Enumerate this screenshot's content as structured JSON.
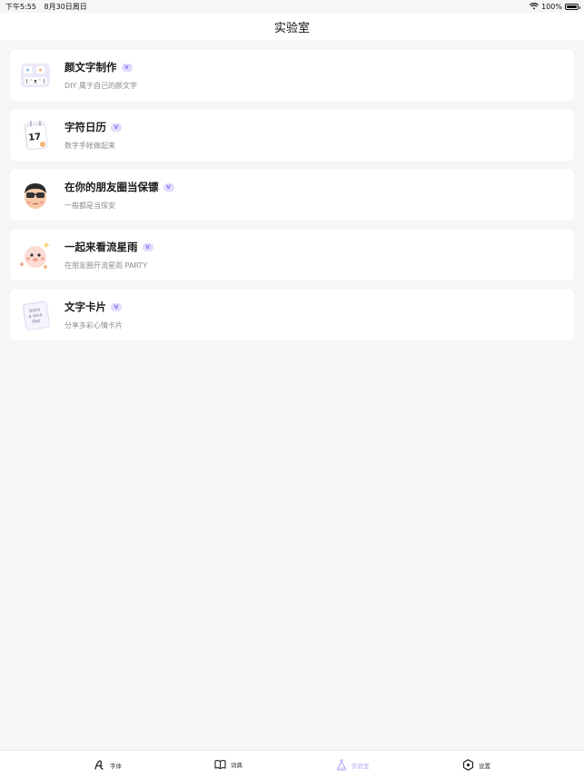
{
  "status_bar": {
    "time": "下午5:55",
    "date": "8月30日周日",
    "battery": "100%"
  },
  "nav": {
    "title": "实验室"
  },
  "items": [
    {
      "title": "颜文字制作",
      "subtitle": "DIY 属于自己的颜文字",
      "icon": "kaomoji-keyboard-icon",
      "badge": "V"
    },
    {
      "title": "字符日历",
      "subtitle": "数字手帐做起来",
      "icon": "calendar-icon",
      "badge": "V",
      "calendar_day": "17"
    },
    {
      "title": "在你的朋友圈当保镖",
      "subtitle": "一般都是当保安",
      "icon": "bodyguard-avatar-icon",
      "badge": "V"
    },
    {
      "title": "一起来看流星雨",
      "subtitle": "在朋友圈开流星雨 PARTY",
      "icon": "meteor-shower-icon",
      "badge": "V"
    },
    {
      "title": "文字卡片",
      "subtitle": "分享多彩心情卡片",
      "icon": "text-card-icon",
      "badge": "V",
      "card_text": "have a nice day"
    }
  ],
  "tabs": [
    {
      "label": "字体",
      "icon": "font-icon",
      "active": false
    },
    {
      "label": "词典",
      "icon": "book-icon",
      "active": false
    },
    {
      "label": "实验室",
      "icon": "flask-icon",
      "active": true
    },
    {
      "label": "设置",
      "icon": "settings-icon",
      "active": false
    }
  ],
  "colors": {
    "accent": "#b6a6f0",
    "badge_bg": "#e3dcff",
    "badge_fg": "#8a6cf2",
    "background": "#f6f6f7"
  }
}
